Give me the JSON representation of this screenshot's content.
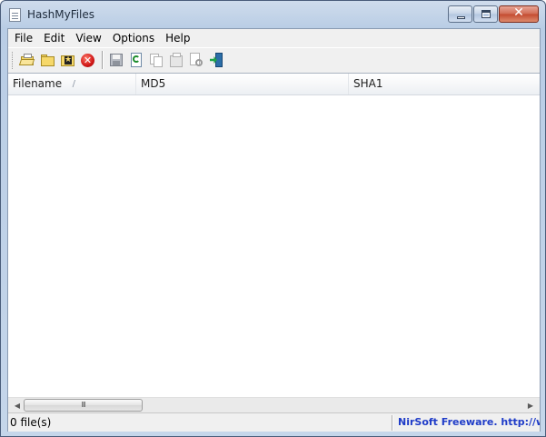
{
  "window": {
    "title": "HashMyFiles"
  },
  "menu": [
    "File",
    "Edit",
    "View",
    "Options",
    "Help"
  ],
  "toolbar": {
    "buttons": [
      "open-files-icon",
      "open-folder-icon",
      "add-wildcard-icon",
      "stop-icon",
      "save-icon",
      "refresh-icon",
      "copy-icon",
      "properties-icon",
      "find-icon",
      "exit-icon"
    ]
  },
  "listview": {
    "columns": [
      "Filename",
      "MD5",
      "SHA1"
    ],
    "sort_indicator": "/",
    "rows": []
  },
  "scrollbar": {
    "thumb_grip": "III"
  },
  "status": {
    "file_count": "0 file(s)",
    "credit": "NirSoft Freeware.  http://www."
  }
}
